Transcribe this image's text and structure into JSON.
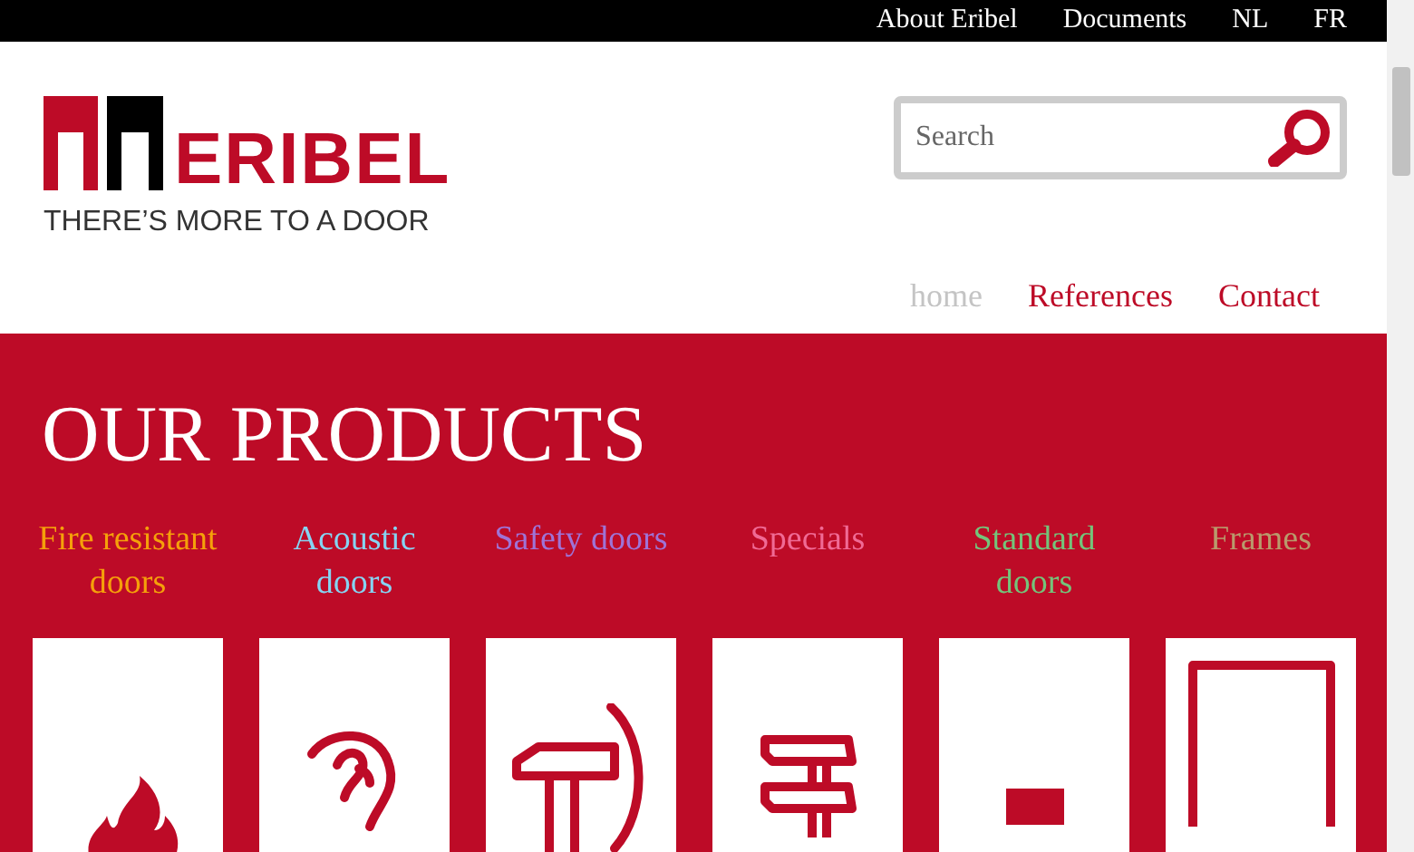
{
  "top_bar": {
    "links": [
      "About Eribel",
      "Documents",
      "NL",
      "FR"
    ]
  },
  "logo": {
    "name": "ERIBEL",
    "tagline": "THERE’S MORE TO A DOOR"
  },
  "search": {
    "placeholder": "Search"
  },
  "nav": [
    {
      "label": "home",
      "selected": true
    },
    {
      "label": "References",
      "selected": false
    },
    {
      "label": "Contact",
      "selected": false
    }
  ],
  "products": {
    "title": "OUR PRODUCTS",
    "items": [
      {
        "label": "Fire resistant doors",
        "color": "#f5a00a",
        "kind": "fire"
      },
      {
        "label": "Acoustic doors",
        "color": "#86d4f2",
        "kind": "ear"
      },
      {
        "label": "Safety doors",
        "color": "#9f73d6",
        "kind": "hammer"
      },
      {
        "label": "Specials",
        "color": "#f06a95",
        "kind": "clamp"
      },
      {
        "label": "Standard doors",
        "color": "#74c47a",
        "kind": "block"
      },
      {
        "label": "Frames",
        "color": "#b99a6c",
        "kind": "frame"
      }
    ]
  }
}
